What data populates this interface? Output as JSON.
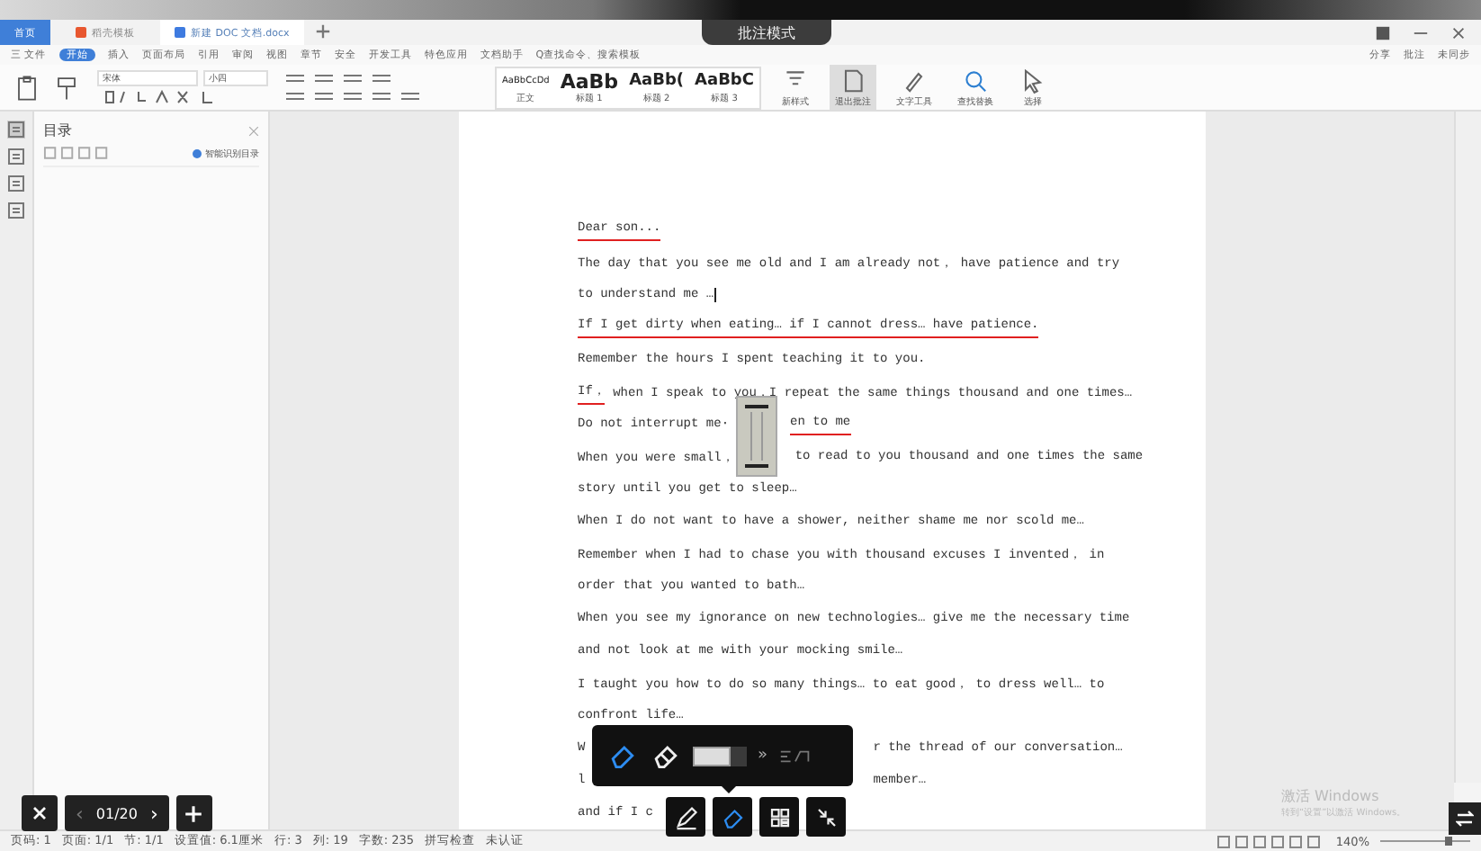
{
  "tabs": [
    {
      "label": "首页",
      "kind": "home",
      "selected": false
    },
    {
      "label": "稻壳模板",
      "kind": "template",
      "selected": false
    },
    {
      "label": "新建 DOC 文档.docx",
      "kind": "doc",
      "selected": true
    }
  ],
  "mode_banner": "批注模式",
  "menu": [
    {
      "label": "三 文件",
      "selected": false
    },
    {
      "label": "开始",
      "selected": true
    },
    {
      "label": "插入",
      "selected": false
    },
    {
      "label": "页面布局",
      "selected": false
    },
    {
      "label": "引用",
      "selected": false
    },
    {
      "label": "审阅",
      "selected": false
    },
    {
      "label": "视图",
      "selected": false
    },
    {
      "label": "章节",
      "selected": false
    },
    {
      "label": "安全",
      "selected": false
    },
    {
      "label": "开发工具",
      "selected": false
    },
    {
      "label": "特色应用",
      "selected": false
    },
    {
      "label": "文档助手",
      "selected": false
    },
    {
      "label": "Q查找命令、搜索模板",
      "selected": false
    }
  ],
  "menu_right": [
    "分享",
    "批注",
    "未同步"
  ],
  "font": {
    "name": "宋体",
    "size": "小四"
  },
  "styles": [
    {
      "sample": "AaBbCcDd",
      "label": "正文",
      "kind": "small"
    },
    {
      "sample": "AaBb",
      "label": "标题 1",
      "kind": "h1"
    },
    {
      "sample": "AaBb(",
      "label": "标题 2",
      "kind": "h2"
    },
    {
      "sample": "AaBbC",
      "label": "标题 3",
      "kind": "h3"
    }
  ],
  "tools": [
    {
      "label": "新样式",
      "kind": "styles",
      "selected": false
    },
    {
      "label": "退出批注",
      "kind": "doc",
      "selected": true
    },
    {
      "label": "文字工具",
      "kind": "brush",
      "selected": false
    },
    {
      "label": "查找替换",
      "kind": "search",
      "selected": false
    },
    {
      "label": "选择",
      "kind": "pointer",
      "selected": false
    }
  ],
  "sidebar": {
    "title": "目录",
    "toggle": "智能识别目录"
  },
  "document": {
    "lines": [
      {
        "segments": [
          {
            "kind": "text",
            "text": "Dear son...",
            "underline": true
          }
        ]
      },
      {
        "segments": [
          {
            "kind": "text",
            "text": "The day that you see me old and I am already not， have patience and try",
            "underline": false
          }
        ]
      },
      {
        "segments": [
          {
            "kind": "text",
            "text": "to understand me …",
            "underline": false
          },
          {
            "kind": "cursor"
          }
        ]
      },
      {
        "segments": [
          {
            "kind": "text",
            "text": "If I get dirty when eating… if I cannot dress… have patience.",
            "underline": true
          }
        ]
      },
      {
        "segments": [
          {
            "kind": "text",
            "text": "Remember the hours I spent teaching it to you.",
            "underline": false
          }
        ]
      },
      {
        "segments": [
          {
            "kind": "text",
            "text": "If，",
            "underline": true
          },
          {
            "kind": "text",
            "text": " when I speak to you，I repeat the same things thousand and one times…",
            "underline": false
          }
        ]
      },
      {
        "segments": [
          {
            "kind": "text",
            "text": "Do not interrupt me·",
            "underline": false
          },
          {
            "kind": "gap"
          },
          {
            "kind": "text",
            "text": "en to me",
            "underline": true
          }
        ]
      },
      {
        "segments": [
          {
            "kind": "text",
            "text": "When you were small，",
            "underline": false
          },
          {
            "kind": "gap"
          },
          {
            "kind": "text",
            "text": "to read to you thousand and one times the same",
            "underline": false
          }
        ]
      },
      {
        "segments": [
          {
            "kind": "text",
            "text": "story until you get to sleep…",
            "underline": false
          }
        ]
      },
      {
        "segments": [
          {
            "kind": "text",
            "text": "When I do not want to have a shower, neither shame me nor scold me…",
            "underline": false
          }
        ]
      },
      {
        "segments": [
          {
            "kind": "text",
            "text": "Remember when I had to chase you with thousand excuses I invented， in",
            "underline": false
          }
        ]
      },
      {
        "segments": [
          {
            "kind": "text",
            "text": "order that you wanted to bath…",
            "underline": false
          }
        ]
      },
      {
        "segments": [
          {
            "kind": "text",
            "text": "When you see my ignorance on new technologies… give me the necessary time",
            "underline": false
          }
        ]
      },
      {
        "segments": [
          {
            "kind": "text",
            "text": "and not look at me with your mocking smile…",
            "underline": false
          }
        ]
      },
      {
        "segments": [
          {
            "kind": "text",
            "text": "I taught you how to do so many things… to eat good， to dress well… to",
            "underline": false
          }
        ]
      },
      {
        "segments": [
          {
            "kind": "text",
            "text": "confront life…",
            "underline": false
          }
        ]
      },
      {
        "segments": [
          {
            "kind": "text",
            "text": "W",
            "underline": false
          },
          {
            "kind": "biggap"
          },
          {
            "kind": "text",
            "text": "r the thread of our conversation…",
            "underline": false
          }
        ]
      },
      {
        "segments": [
          {
            "kind": "text",
            "text": "l",
            "underline": false
          },
          {
            "kind": "biggap"
          },
          {
            "kind": "text",
            "text": "member…",
            "underline": false
          }
        ]
      },
      {
        "segments": [
          {
            "kind": "text",
            "text": "and if I c",
            "underline": false
          }
        ]
      }
    ]
  },
  "pen_toolbar": {
    "top": [
      {
        "kind": "eraser-stroke",
        "selected": true
      },
      {
        "kind": "eraser",
        "selected": false
      }
    ],
    "size": {
      "level": 0.7
    },
    "more": "»",
    "bottom": [
      {
        "kind": "pen",
        "selected": false
      },
      {
        "kind": "eraser-stroke",
        "selected": true
      },
      {
        "kind": "grid",
        "selected": false
      },
      {
        "kind": "shrink",
        "selected": false
      }
    ]
  },
  "page_nav": {
    "prev": "‹",
    "page": "01/20",
    "next": "›"
  },
  "watermark": {
    "title": "激活 Windows",
    "text": "转到“设置”以激活 Windows。"
  },
  "status": [
    "页码: 1",
    "页面: 1/1",
    "节: 1/1",
    "设置值: 6.1厘米",
    "行: 3",
    "列: 19",
    "字数: 235",
    "拼写检查",
    "未认证"
  ],
  "zoom": {
    "label": "140%",
    "level": 0.75
  }
}
